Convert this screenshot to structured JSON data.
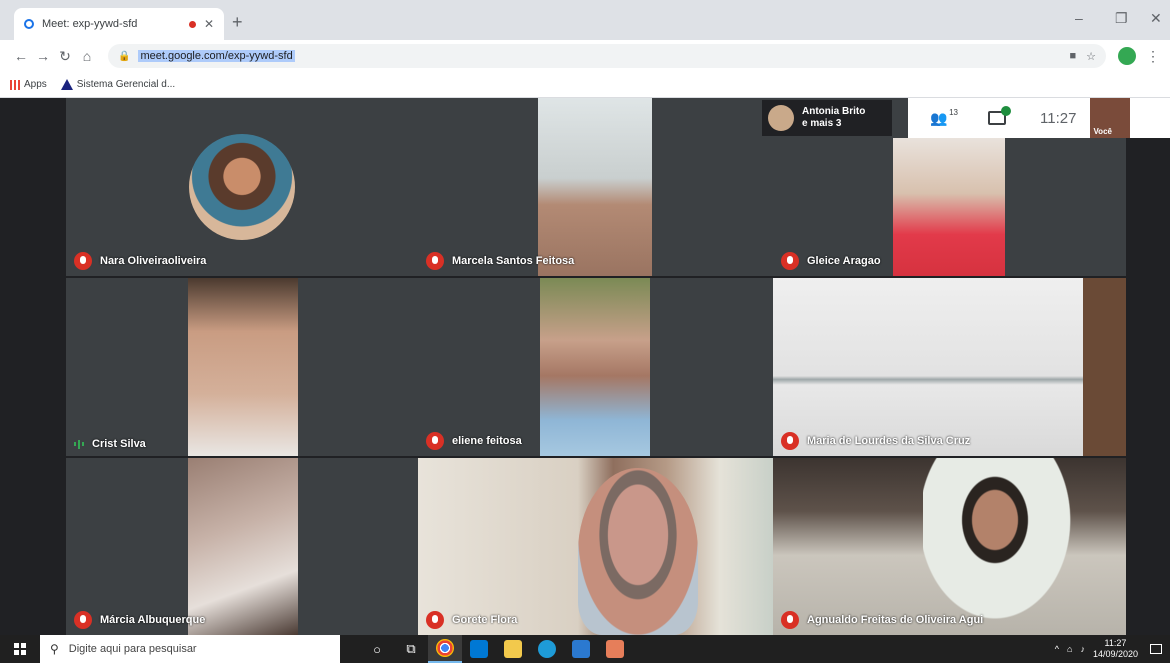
{
  "browser": {
    "tab_title": "Meet: exp-yywd-sfd",
    "tab_close": "✕",
    "new_tab": "+",
    "url": "meet.google.com/exp-yywd-sfd",
    "bookmarks": [
      {
        "label": "Apps"
      },
      {
        "label": "Sistema Gerencial d..."
      }
    ],
    "window_controls": {
      "minimize": "–",
      "restore": "❐",
      "close": "✕"
    }
  },
  "meet": {
    "presenter": {
      "line1": "Antonia Brito",
      "line2": "e mais 3"
    },
    "people_count": "13",
    "time": "11:27",
    "self_label": "Você",
    "tiles": [
      {
        "name": "Nara Oliveiraoliveira",
        "mic": "muted"
      },
      {
        "name": "Marcela Santos Feitosa",
        "mic": "muted"
      },
      {
        "name": "Gleice Aragao",
        "mic": "muted"
      },
      {
        "name": "Crist Silva",
        "mic": "speaking"
      },
      {
        "name": "eliene feitosa",
        "mic": "muted"
      },
      {
        "name": "Maria de Lourdes da Silva Cruz",
        "mic": "muted"
      },
      {
        "name": "Márcia Albuquerque",
        "mic": "muted"
      },
      {
        "name": "Gorete Flora",
        "mic": "muted"
      },
      {
        "name": "Agnualdo Freitas de Oliveira Agui",
        "mic": "muted"
      }
    ]
  },
  "taskbar": {
    "search_placeholder": "Digite aqui para pesquisar",
    "time": "11:27",
    "date": "14/09/2020"
  },
  "colors": {
    "meet_bg": "#202124",
    "muted_red": "#d93025",
    "speaking_green": "#34a853",
    "url_highlight": "#aecbfa"
  }
}
